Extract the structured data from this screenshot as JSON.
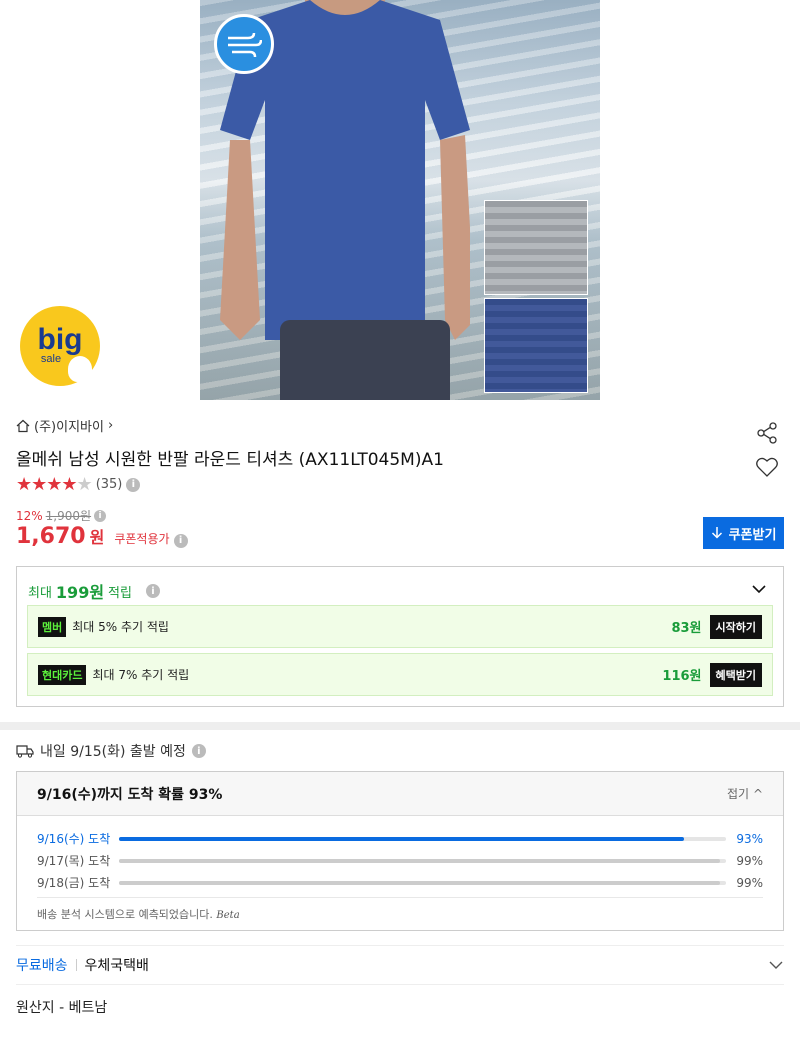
{
  "product": {
    "store_name": "(주)이지바이",
    "title": "올메쉬 남성 시원한 반팔 라운드 티셔츠 (AX11LT045M)A1",
    "rating_count": "(35)",
    "rating_value": 4.5,
    "discount_pct": "12%",
    "original_price": "1,900원",
    "price": "1,670",
    "price_unit": "원",
    "coupon_note": "쿠폰적용가",
    "coupon_button": "쿠폰받기",
    "badge_big": "big",
    "badge_sale": "sale"
  },
  "reward": {
    "prefix": "최대",
    "amount": "199원",
    "suffix": "적립",
    "rows": [
      {
        "tag": "멤버",
        "text": "최대 5% 추기 적립",
        "amount": "83원",
        "button": "시작하기"
      },
      {
        "tag": "현대카드",
        "text": "최대 7% 추기 적립",
        "amount": "116원",
        "button": "혜택받기"
      }
    ]
  },
  "shipping": {
    "departure": "내일 9/15(화) 출발 예정",
    "headline": "9/16(수)까지 도착 확률 93%",
    "fold_label": "접기",
    "rows": [
      {
        "label": "9/16(수) 도착",
        "percent": "93%",
        "value": 0.93
      },
      {
        "label": "9/17(목) 도착",
        "percent": "99%",
        "value": 0.99
      },
      {
        "label": "9/18(금) 도착",
        "percent": "99%",
        "value": 0.99
      }
    ],
    "note": "배송 분석 시스템으로 예측되었습니다.",
    "beta": "Beta",
    "free_label": "무료배송",
    "carrier": "우체국택배"
  },
  "origin": "원산지 - 베트남",
  "colors": {
    "accent": "#0a6be0",
    "price": "#e0333c",
    "reward": "#1a9c3a"
  }
}
